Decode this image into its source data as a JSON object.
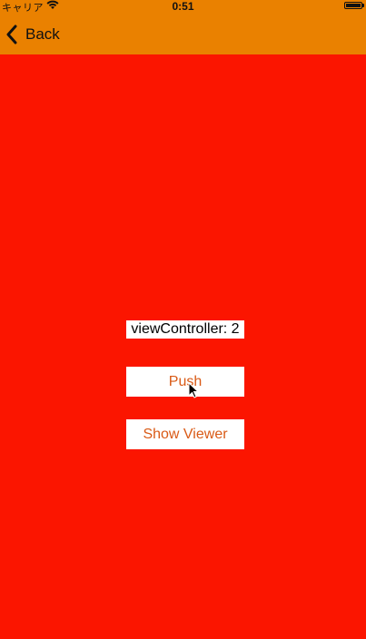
{
  "status_bar": {
    "carrier": "キャリア",
    "time": "0:51",
    "wifi_icon": "wifi-icon",
    "battery_icon": "battery-icon"
  },
  "nav_bar": {
    "back_label": "Back",
    "back_icon": "chevron-left-icon",
    "color": "#ea8100"
  },
  "main": {
    "background_color": "#fb1500",
    "title_label": "viewController: 2",
    "buttons": {
      "push_label": "Push",
      "show_viewer_label": "Show Viewer"
    },
    "button_text_color": "#d95a16"
  }
}
